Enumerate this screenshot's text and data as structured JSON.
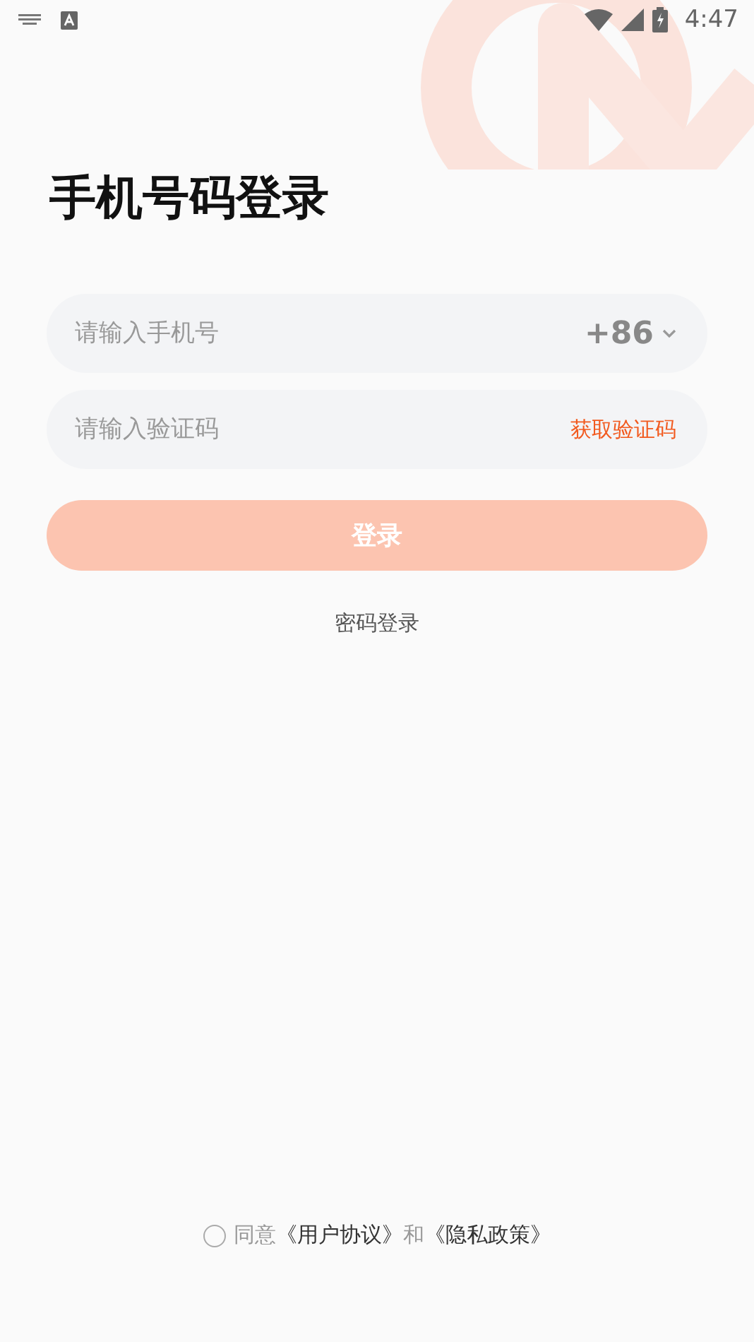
{
  "status_bar": {
    "time": "4:47"
  },
  "title": "手机号码登录",
  "phone_field": {
    "placeholder": "请输入手机号",
    "country_code": "+86"
  },
  "code_field": {
    "placeholder": "请输入验证码",
    "action": "获取验证码"
  },
  "login_button": {
    "label": "登录",
    "disabled": true
  },
  "password_login_link": "密码登录",
  "agreement": {
    "agreed": false,
    "parts": [
      {
        "kind": "text",
        "text": "同意"
      },
      {
        "kind": "link",
        "text": "《用户协议》"
      },
      {
        "kind": "text",
        "text": "和"
      },
      {
        "kind": "link",
        "text": "《隐私政策》"
      }
    ]
  }
}
